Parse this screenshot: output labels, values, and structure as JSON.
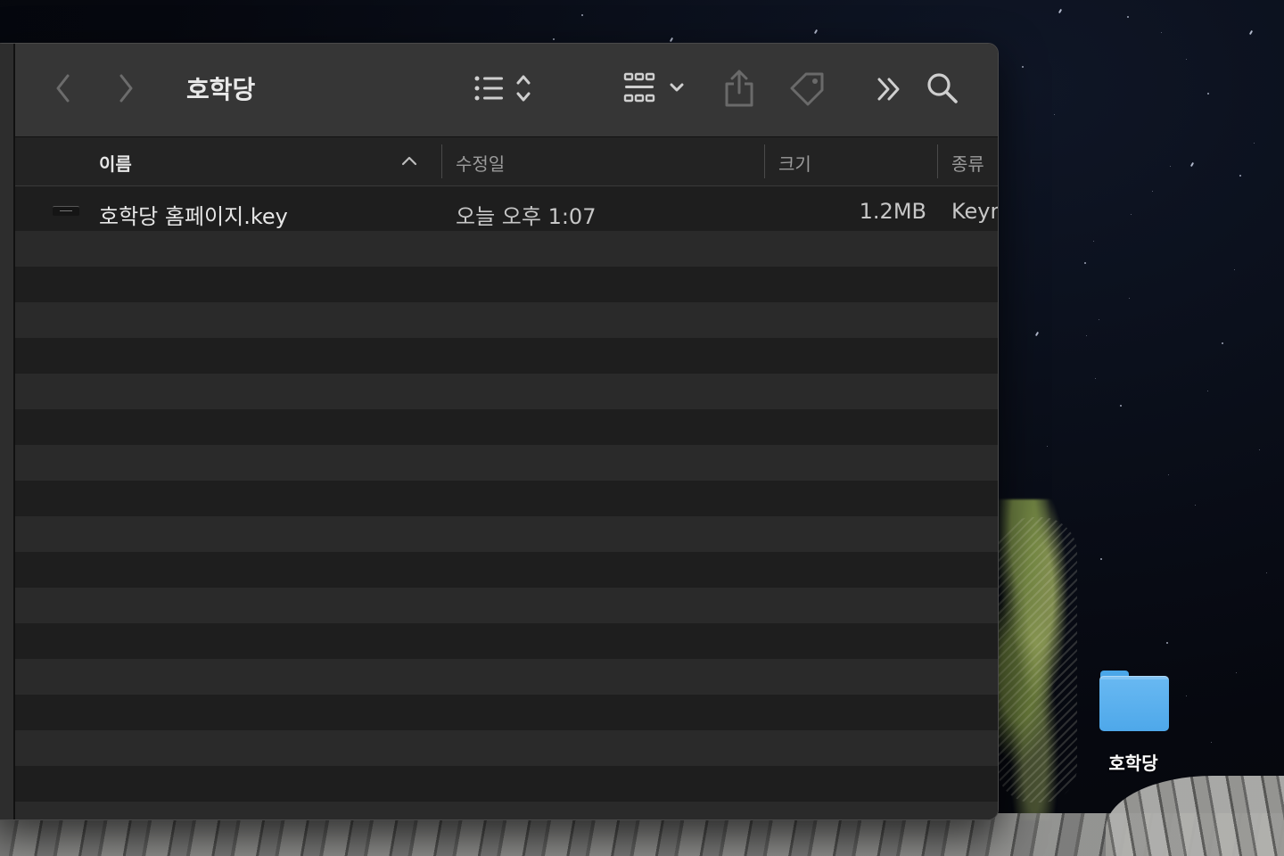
{
  "window": {
    "title": "호학당"
  },
  "toolbar": {
    "back_icon": "chevron-left-icon",
    "forward_icon": "chevron-right-icon",
    "view_icon": "list-view-icon",
    "group_icon": "grid-view-icon",
    "share_icon": "share-icon",
    "tag_icon": "tag-icon",
    "more_icon": "double-chevron-icon",
    "search_icon": "search-icon"
  },
  "columns": {
    "name": "이름",
    "modified": "수정일",
    "size": "크기",
    "kind": "종류"
  },
  "files": [
    {
      "name": "호학당 홈페이지.key",
      "modified": "오늘 오후 1:07",
      "size": "1.2MB",
      "kind": "Keyn"
    }
  ],
  "desktop": {
    "folder_label": "호학당"
  },
  "colors": {
    "window_bg": "#1e1e1e",
    "toolbar_bg": "#363636",
    "folder_blue": "#5bb1ee"
  }
}
